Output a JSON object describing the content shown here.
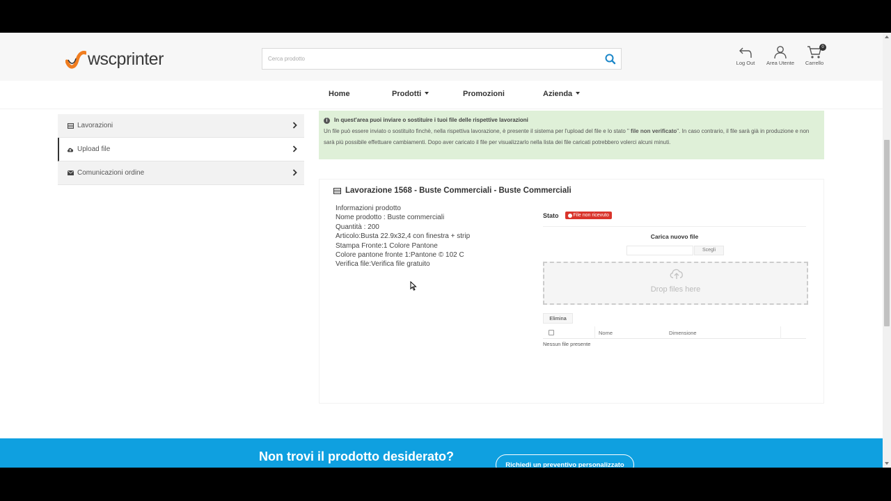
{
  "header": {
    "logo_text": "wscprinter",
    "search_placeholder": "Cerca prodotto",
    "actions": {
      "logout": "Log Out",
      "account": "Area Utente",
      "cart": "Carrello",
      "cart_count": "0"
    }
  },
  "nav": {
    "items": [
      "Home",
      "Prodotti",
      "Promozioni",
      "Azienda"
    ]
  },
  "sidebar": {
    "items": [
      {
        "label": "Lavorazioni",
        "icon": "list-icon"
      },
      {
        "label": "Upload file",
        "icon": "cloud-upload-icon"
      },
      {
        "label": "Comunicazioni ordine",
        "icon": "envelope-icon"
      }
    ]
  },
  "alert": {
    "title": "In quest'area puoi inviare o sostituire i tuoi file delle rispettive lavorazioni",
    "body_part1": "Un file può essere inviato o sostituito finchè, nella rispettiva lavorazione, è presente il sistema per l'upload del file e lo stato \"",
    "body_bold": " file non verificato",
    "body_part2": "\". In caso contrario, il file sarà già in produzione e non sarà più possibile effettuare cambiamenti. Dopo aver caricato il file per visualizzarlo nella lista dei file caricati potrebbero volerci alcuni minuti."
  },
  "job": {
    "title": "Lavorazione 1568 - Buste Commerciali - Buste Commerciali",
    "info": [
      "Informazioni prodotto",
      "Nome prodotto : Buste commerciali",
      "Quantità : 200",
      "Articolo:Busta 22.9x32,4 con finestra + strip",
      "Stampa Fronte:1 Colore Pantone",
      "Colore pantone fronte 1:Pantone © 102 C",
      "Verifica file:Verifica file gratuito"
    ],
    "status_label": "Stato",
    "status_badge": "File non ricevuto",
    "upload_title": "Carica nuovo file",
    "choose_label": "Scegli",
    "drop_text": "Drop files here",
    "delete_label": "Elimina",
    "table_headers": [
      "Nome",
      "Dimensione"
    ],
    "empty_message": "Nessun file presente"
  },
  "banner": {
    "title": "Non trovi il prodotto desiderato?",
    "button": "Richiedi un preventivo personalizzato"
  },
  "colors": {
    "brand_orange": "#f07d20",
    "banner_blue": "#0fa0e0",
    "alert_green": "#dff0d8",
    "badge_red": "#d9342b"
  }
}
